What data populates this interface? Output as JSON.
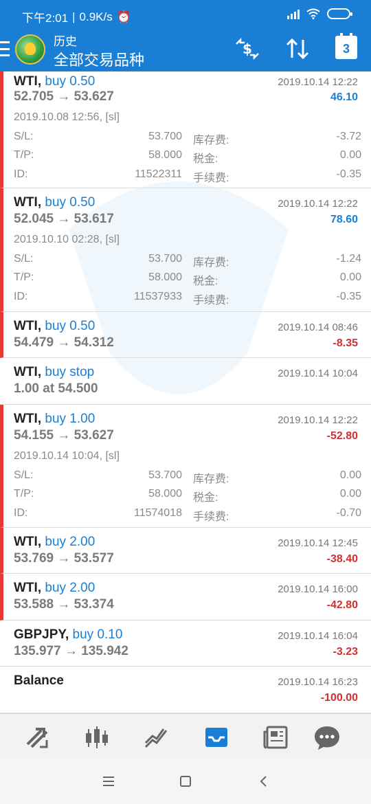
{
  "status": {
    "time": "下午2:01",
    "speed": "0.9K/s"
  },
  "header": {
    "small_title": "历史",
    "main_title": "全部交易品种",
    "calendar_day": "3"
  },
  "trades": [
    {
      "symbol": "WTI,",
      "type": "buy 0.50",
      "price": "52.705 → 53.627",
      "time": "2019.10.14 12:22",
      "profit": "46.10",
      "open_time": "2019.10.08 12:56, [sl]",
      "sl_label": "S/L:",
      "sl": "53.700",
      "tp_label": "T/P:",
      "tp": "58.000",
      "id_label": "ID:",
      "id": "11522311",
      "swap_label": "库存费:",
      "swap": "-3.72",
      "tax_label": "税金:",
      "tax": "0.00",
      "fee_label": "手续费:",
      "fee": "-0.35"
    },
    {
      "symbol": "WTI,",
      "type": "buy 0.50",
      "price": "52.045 → 53.617",
      "time": "2019.10.14 12:22",
      "profit": "78.60",
      "open_time": "2019.10.10 02:28, [sl]",
      "sl_label": "S/L:",
      "sl": "53.700",
      "tp_label": "T/P:",
      "tp": "58.000",
      "id_label": "ID:",
      "id": "11537933",
      "swap_label": "库存费:",
      "swap": "-1.24",
      "tax_label": "税金:",
      "tax": "0.00",
      "fee_label": "手续费:",
      "fee": "-0.35"
    },
    {
      "symbol": "WTI,",
      "type": "buy 0.50",
      "price": "54.479 → 54.312",
      "time": "2019.10.14 08:46",
      "profit": "-8.35"
    },
    {
      "symbol": "WTI,",
      "type": "buy stop",
      "price": "1.00 at 54.500",
      "time": "2019.10.14 10:04"
    },
    {
      "symbol": "WTI,",
      "type": "buy 1.00",
      "price": "54.155 → 53.627",
      "time": "2019.10.14 12:22",
      "profit": "-52.80",
      "open_time": "2019.10.14 10:04, [sl]",
      "sl_label": "S/L:",
      "sl": "53.700",
      "tp_label": "T/P:",
      "tp": "58.000",
      "id_label": "ID:",
      "id": "11574018",
      "swap_label": "库存费:",
      "swap": "0.00",
      "tax_label": "税金:",
      "tax": "0.00",
      "fee_label": "手续费:",
      "fee": "-0.70"
    },
    {
      "symbol": "WTI,",
      "type": "buy 2.00",
      "price": "53.769 → 53.577",
      "time": "2019.10.14 12:45",
      "profit": "-38.40"
    },
    {
      "symbol": "WTI,",
      "type": "buy 2.00",
      "price": "53.588 → 53.374",
      "time": "2019.10.14 16:00",
      "profit": "-42.80"
    },
    {
      "symbol": "GBPJPY,",
      "type": "buy 0.10",
      "price": "135.977 → 135.942",
      "time": "2019.10.14 16:04",
      "profit": "-3.23"
    },
    {
      "symbol": "Balance",
      "time": "2019.10.14 16:23",
      "profit": "-100.00"
    }
  ],
  "colors": {
    "header_blue": "#1a7fd4",
    "profit_positive": "#1a7fd4",
    "profit_negative": "#d32f2f",
    "row_marker": "#e53935"
  },
  "bottom_nav": [
    "quotes-icon",
    "chart-icon",
    "trade-icon",
    "history-icon",
    "news-icon",
    "chat-icon"
  ],
  "system_nav": [
    "menu-icon",
    "home-icon",
    "back-icon"
  ]
}
